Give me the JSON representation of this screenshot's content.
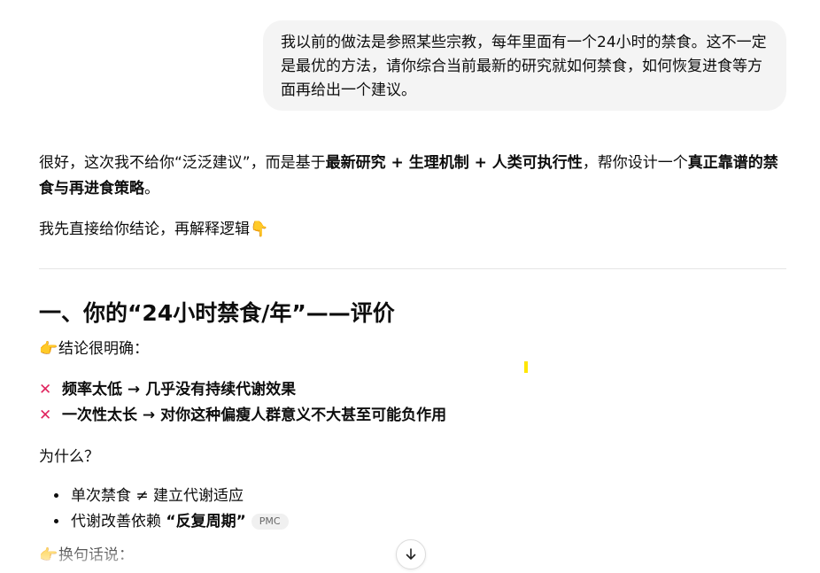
{
  "user_message": {
    "text": "我以前的做法是参照某些宗教，每年里面有一个24小时的禁食。这不一定是最优的方法，请你综合当前最新的研究就如何禁食，如何恢复进食等方面再给出一个建议。"
  },
  "assistant": {
    "intro": {
      "part1": "很好，这次我不给你“泛泛建议”，而是基于",
      "bold1": "最新研究 + 生理机制 + 人类可执行性",
      "part2": "，帮你设计一个",
      "bold2": "真正靠谱的禁食与再进食策略",
      "part3": "。"
    },
    "logic_line": "我先直接给你结论，再解释逻辑",
    "logic_emoji": "👇",
    "section1": {
      "heading": "一、你的“24小时禁食/年”——评价",
      "conclusion_emoji": "👉",
      "conclusion": "结论很明确：",
      "cross_icon": "✕",
      "point1": "频率太低 → 几乎没有持续代谢效果",
      "point2": "一次性太长 → 对你这种偏瘦人群意义不大甚至可能负作用",
      "why": "为什么？",
      "bullets": [
        {
          "text": "单次禁食 ≠ 建立代谢适应"
        },
        {
          "prefix": "代谢改善依赖 ",
          "bold": "“反复周期”",
          "citation": "PMC"
        }
      ],
      "rephrase_emoji": "👉",
      "rephrase": "换句话说："
    }
  },
  "scroll_button": {
    "icon": "arrow-down-icon"
  }
}
